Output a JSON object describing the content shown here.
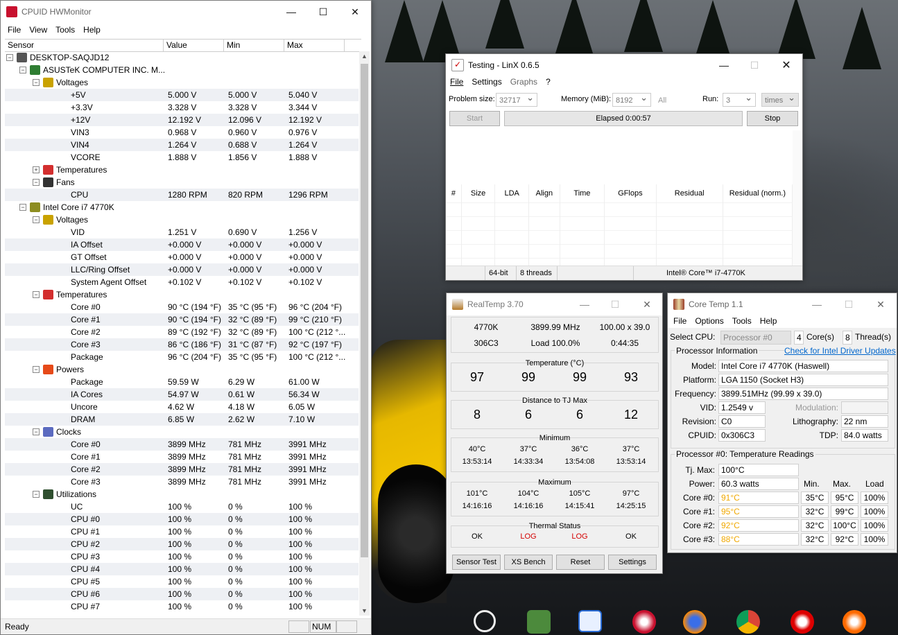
{
  "hwmonitor": {
    "title": "CPUID HWMonitor",
    "menu": [
      "File",
      "View",
      "Tools",
      "Help"
    ],
    "columns": [
      "Sensor",
      "Value",
      "Min",
      "Max"
    ],
    "rows": [
      {
        "name": "DESKTOP-SAQJD12",
        "level": 0,
        "type": "computer"
      },
      {
        "name": "ASUSTeK COMPUTER INC. M...",
        "level": 1,
        "type": "board"
      },
      {
        "name": "Voltages",
        "level": 2,
        "type": "volt"
      },
      {
        "name": "+5V",
        "level": 3,
        "value": "5.000 V",
        "min": "5.000 V",
        "max": "5.040 V"
      },
      {
        "name": "+3.3V",
        "level": 3,
        "value": "3.328 V",
        "min": "3.328 V",
        "max": "3.344 V"
      },
      {
        "name": "+12V",
        "level": 3,
        "value": "12.192 V",
        "min": "12.096 V",
        "max": "12.192 V"
      },
      {
        "name": "VIN3",
        "level": 3,
        "value": "0.968 V",
        "min": "0.960 V",
        "max": "0.976 V"
      },
      {
        "name": "VIN4",
        "level": 3,
        "value": "1.264 V",
        "min": "0.688 V",
        "max": "1.264 V"
      },
      {
        "name": "VCORE",
        "level": 3,
        "value": "1.888 V",
        "min": "1.856 V",
        "max": "1.888 V"
      },
      {
        "name": "Temperatures",
        "level": 2,
        "type": "temp",
        "collapsed": true
      },
      {
        "name": "Fans",
        "level": 2,
        "type": "fan"
      },
      {
        "name": "CPU",
        "level": 3,
        "value": "1280 RPM",
        "min": "820 RPM",
        "max": "1296 RPM"
      },
      {
        "name": "Intel Core i7 4770K",
        "level": 1,
        "type": "chip"
      },
      {
        "name": "Voltages",
        "level": 2,
        "type": "volt"
      },
      {
        "name": "VID",
        "level": 3,
        "value": "1.251 V",
        "min": "0.690 V",
        "max": "1.256 V"
      },
      {
        "name": "IA Offset",
        "level": 3,
        "value": "+0.000 V",
        "min": "+0.000 V",
        "max": "+0.000 V"
      },
      {
        "name": "GT Offset",
        "level": 3,
        "value": "+0.000 V",
        "min": "+0.000 V",
        "max": "+0.000 V"
      },
      {
        "name": "LLC/Ring Offset",
        "level": 3,
        "value": "+0.000 V",
        "min": "+0.000 V",
        "max": "+0.000 V"
      },
      {
        "name": "System Agent Offset",
        "level": 3,
        "value": "+0.102 V",
        "min": "+0.102 V",
        "max": "+0.102 V"
      },
      {
        "name": "Temperatures",
        "level": 2,
        "type": "temp"
      },
      {
        "name": "Core #0",
        "level": 3,
        "value": "90 °C  (194 °F)",
        "min": "35 °C  (95 °F)",
        "max": "96 °C  (204 °F)"
      },
      {
        "name": "Core #1",
        "level": 3,
        "value": "90 °C  (194 °F)",
        "min": "32 °C  (89 °F)",
        "max": "99 °C  (210 °F)"
      },
      {
        "name": "Core #2",
        "level": 3,
        "value": "89 °C  (192 °F)",
        "min": "32 °C  (89 °F)",
        "max": "100 °C  (212 °..."
      },
      {
        "name": "Core #3",
        "level": 3,
        "value": "86 °C  (186 °F)",
        "min": "31 °C  (87 °F)",
        "max": "92 °C  (197 °F)"
      },
      {
        "name": "Package",
        "level": 3,
        "value": "96 °C  (204 °F)",
        "min": "35 °C  (95 °F)",
        "max": "100 °C  (212 °..."
      },
      {
        "name": "Powers",
        "level": 2,
        "type": "power"
      },
      {
        "name": "Package",
        "level": 3,
        "value": "59.59 W",
        "min": "6.29 W",
        "max": "61.00 W"
      },
      {
        "name": "IA Cores",
        "level": 3,
        "value": "54.97 W",
        "min": "0.61 W",
        "max": "56.34 W"
      },
      {
        "name": "Uncore",
        "level": 3,
        "value": "4.62 W",
        "min": "4.18 W",
        "max": "6.05 W"
      },
      {
        "name": "DRAM",
        "level": 3,
        "value": "6.85 W",
        "min": "2.62 W",
        "max": "7.10 W"
      },
      {
        "name": "Clocks",
        "level": 2,
        "type": "clock"
      },
      {
        "name": "Core #0",
        "level": 3,
        "value": "3899 MHz",
        "min": "781 MHz",
        "max": "3991 MHz"
      },
      {
        "name": "Core #1",
        "level": 3,
        "value": "3899 MHz",
        "min": "781 MHz",
        "max": "3991 MHz"
      },
      {
        "name": "Core #2",
        "level": 3,
        "value": "3899 MHz",
        "min": "781 MHz",
        "max": "3991 MHz"
      },
      {
        "name": "Core #3",
        "level": 3,
        "value": "3899 MHz",
        "min": "781 MHz",
        "max": "3991 MHz"
      },
      {
        "name": "Utilizations",
        "level": 2,
        "type": "util"
      },
      {
        "name": "UC",
        "level": 3,
        "value": "100 %",
        "min": "0 %",
        "max": "100 %"
      },
      {
        "name": "CPU #0",
        "level": 3,
        "value": "100 %",
        "min": "0 %",
        "max": "100 %"
      },
      {
        "name": "CPU #1",
        "level": 3,
        "value": "100 %",
        "min": "0 %",
        "max": "100 %"
      },
      {
        "name": "CPU #2",
        "level": 3,
        "value": "100 %",
        "min": "0 %",
        "max": "100 %"
      },
      {
        "name": "CPU #3",
        "level": 3,
        "value": "100 %",
        "min": "0 %",
        "max": "100 %"
      },
      {
        "name": "CPU #4",
        "level": 3,
        "value": "100 %",
        "min": "0 %",
        "max": "100 %"
      },
      {
        "name": "CPU #5",
        "level": 3,
        "value": "100 %",
        "min": "0 %",
        "max": "100 %"
      },
      {
        "name": "CPU #6",
        "level": 3,
        "value": "100 %",
        "min": "0 %",
        "max": "100 %"
      },
      {
        "name": "CPU #7",
        "level": 3,
        "value": "100 %",
        "min": "0 %",
        "max": "100 %"
      }
    ],
    "status": "Ready",
    "status_num": "NUM"
  },
  "linx": {
    "title": "Testing - LinX 0.6.5",
    "menu": [
      "File",
      "Settings",
      "Graphs",
      "?"
    ],
    "problem_size_label": "Problem size:",
    "problem_size": "32717",
    "memory_label": "Memory (MiB):",
    "memory": "8192",
    "all_label": "All",
    "run_label": "Run:",
    "run": "3",
    "run_unit": "times",
    "start_button": "Start",
    "elapsed": "Elapsed 0:00:57",
    "stop_button": "Stop",
    "columns": [
      "#",
      "Size",
      "LDA",
      "Align",
      "Time",
      "GFlops",
      "Residual",
      "Residual (norm.)"
    ],
    "status_bits": "64-bit",
    "status_threads": "8 threads",
    "status_cpu": "Intel® Core™ i7-4770K"
  },
  "realtemp": {
    "title": "RealTemp 3.70",
    "cpu_model": "4770K",
    "frequency": "3899.99 MHz",
    "multiplier": "100.00 x 39.0",
    "cpuid": "306C3",
    "load": "Load 100.0%",
    "elapsed": "0:44:35",
    "temperature_label": "Temperature (°C)",
    "temperatures": [
      "97",
      "99",
      "99",
      "93"
    ],
    "distance_label": "Distance to TJ Max",
    "distances": [
      "8",
      "6",
      "6",
      "12"
    ],
    "minimum_label": "Minimum",
    "min_temps": [
      "40°C",
      "37°C",
      "36°C",
      "37°C"
    ],
    "min_times": [
      "13:53:14",
      "14:33:34",
      "13:54:08",
      "13:53:14"
    ],
    "maximum_label": "Maximum",
    "max_temps": [
      "101°C",
      "104°C",
      "105°C",
      "97°C"
    ],
    "max_times": [
      "14:16:16",
      "14:16:16",
      "14:15:41",
      "14:25:15"
    ],
    "thermal_label": "Thermal Status",
    "thermal_status": [
      "OK",
      "LOG",
      "LOG",
      "OK"
    ],
    "buttons": [
      "Sensor Test",
      "XS Bench",
      "Reset",
      "Settings"
    ]
  },
  "coretemp": {
    "title": "Core Temp 1.1",
    "menu": [
      "File",
      "Options",
      "Tools",
      "Help"
    ],
    "select_cpu_label": "Select CPU:",
    "select_cpu": "Processor #0",
    "cores_count": "4",
    "cores_label": "Core(s)",
    "threads_count": "8",
    "threads_label": "Thread(s)",
    "proc_info_label": "Processor Information",
    "driver_link": "Check for Intel Driver Updates",
    "model_label": "Model:",
    "model": "Intel Core i7 4770K (Haswell)",
    "platform_label": "Platform:",
    "platform": "LGA 1150 (Socket H3)",
    "frequency_label": "Frequency:",
    "frequency": "3899.51MHz (99.99 x 39.0)",
    "vid_label": "VID:",
    "vid": "1.2549 v",
    "modulation_label": "Modulation:",
    "revision_label": "Revision:",
    "revision": "C0",
    "lithography_label": "Lithography:",
    "lithography": "22 nm",
    "cpuid_label": "CPUID:",
    "cpuid": "0x306C3",
    "tdp_label": "TDP:",
    "tdp": "84.0 watts",
    "readings_label": "Processor #0: Temperature Readings",
    "tjmax_label": "Tj. Max:",
    "tjmax": "100°C",
    "power_label": "Power:",
    "power": "60.3 watts",
    "col_min": "Min.",
    "col_max": "Max.",
    "col_load": "Load",
    "cores": [
      {
        "label": "Core #0:",
        "temp": "91°C",
        "min": "35°C",
        "max": "95°C",
        "load": "100%"
      },
      {
        "label": "Core #1:",
        "temp": "95°C",
        "min": "32°C",
        "max": "99°C",
        "load": "100%"
      },
      {
        "label": "Core #2:",
        "temp": "92°C",
        "min": "32°C",
        "max": "100°C",
        "load": "100%"
      },
      {
        "label": "Core #3:",
        "temp": "88°C",
        "min": "32°C",
        "max": "92°C",
        "load": "100%"
      }
    ]
  },
  "colors": {
    "log_red": "#d40000",
    "temp_orange": "#f0a800",
    "link_blue": "#0066cc"
  }
}
